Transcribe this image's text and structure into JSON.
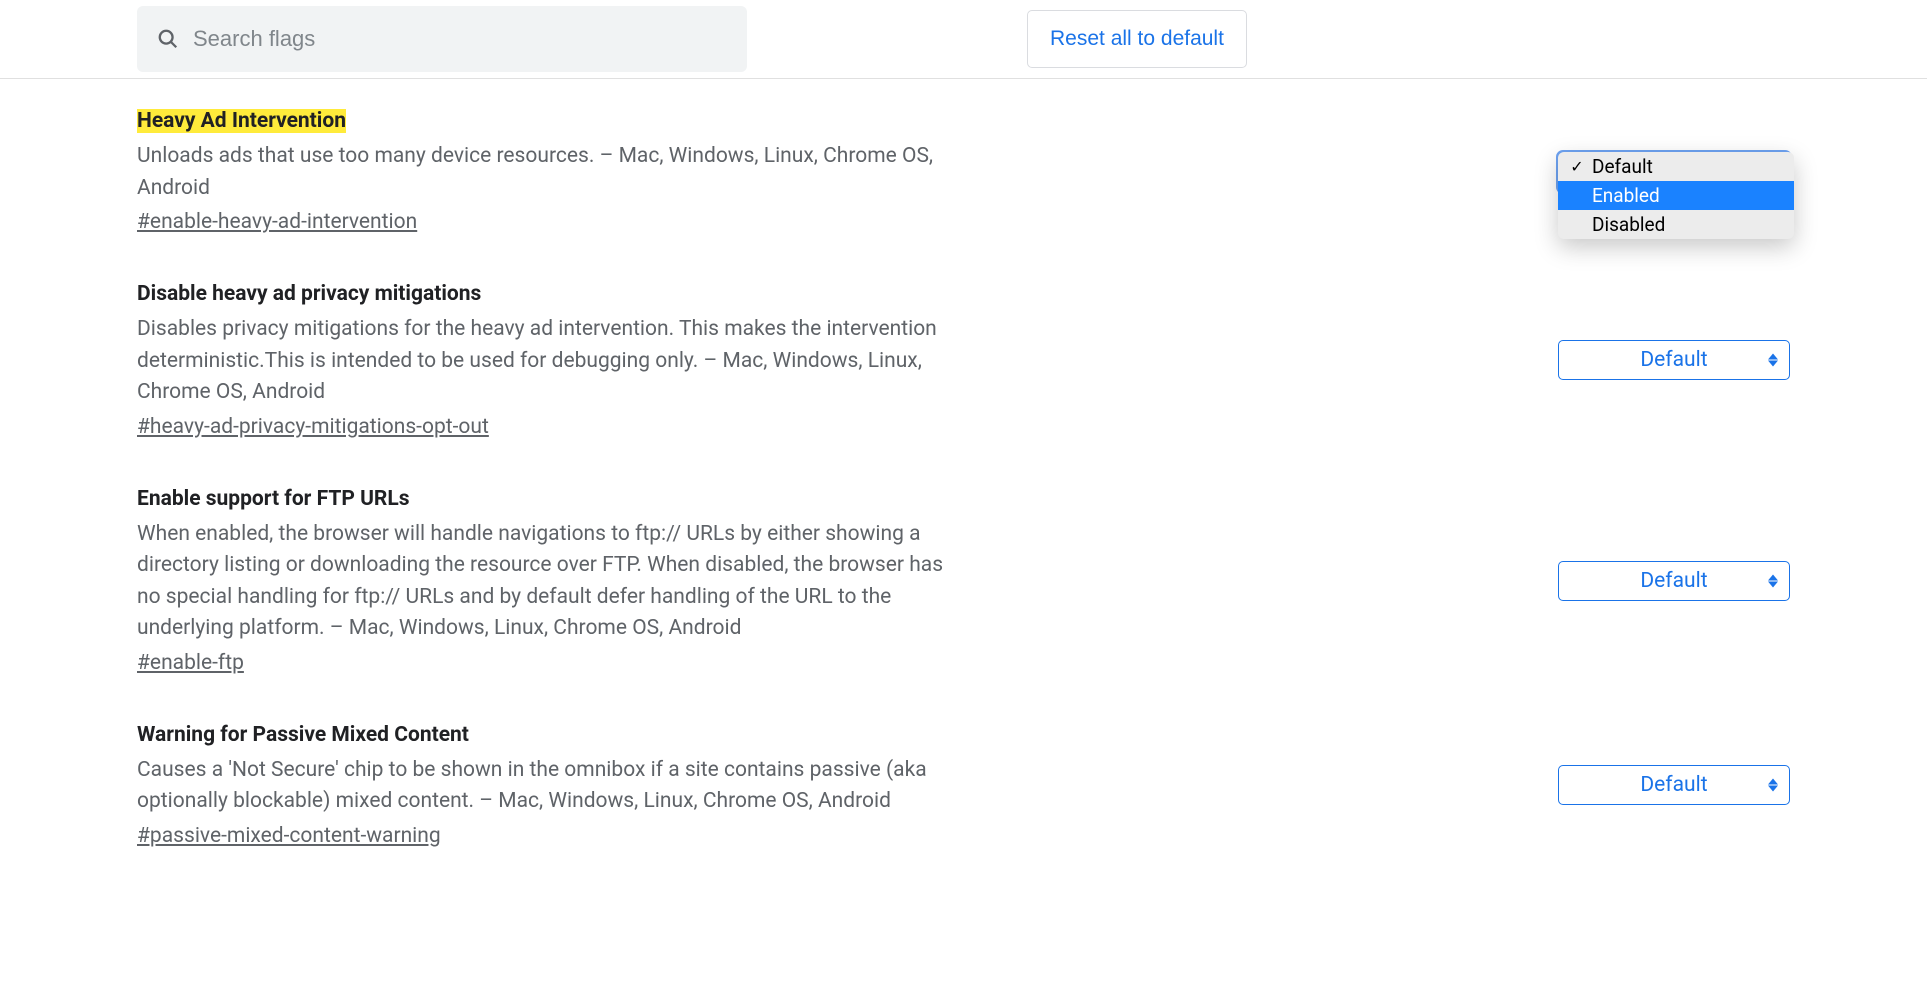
{
  "header": {
    "search_placeholder": "Search flags",
    "reset_label": "Reset all to default"
  },
  "dropdown_options": {
    "default": "Default",
    "enabled": "Enabled",
    "disabled": "Disabled"
  },
  "flags": [
    {
      "title": "Heavy Ad Intervention",
      "highlighted": true,
      "description": "Unloads ads that use too many device resources. – Mac, Windows, Linux, Chrome OS, Android",
      "anchor": "#enable-heavy-ad-intervention",
      "value": "Default",
      "dropdown_open": true,
      "dropdown_hover": "Enabled"
    },
    {
      "title": "Disable heavy ad privacy mitigations",
      "highlighted": false,
      "description": "Disables privacy mitigations for the heavy ad intervention. This makes the intervention deterministic.This is intended to be used for debugging only. – Mac, Windows, Linux, Chrome OS, Android",
      "anchor": "#heavy-ad-privacy-mitigations-opt-out",
      "value": "Default",
      "dropdown_open": false
    },
    {
      "title": "Enable support for FTP URLs",
      "highlighted": false,
      "description": "When enabled, the browser will handle navigations to ftp:// URLs by either showing a directory listing or downloading the resource over FTP. When disabled, the browser has no special handling for ftp:// URLs and by default defer handling of the URL to the underlying platform. – Mac, Windows, Linux, Chrome OS, Android",
      "anchor": "#enable-ftp",
      "value": "Default",
      "dropdown_open": false
    },
    {
      "title": "Warning for Passive Mixed Content",
      "highlighted": false,
      "description": "Causes a 'Not Secure' chip to be shown in the omnibox if a site contains passive (aka optionally blockable) mixed content. – Mac, Windows, Linux, Chrome OS, Android",
      "anchor": "#passive-mixed-content-warning",
      "value": "Default",
      "dropdown_open": false
    }
  ]
}
